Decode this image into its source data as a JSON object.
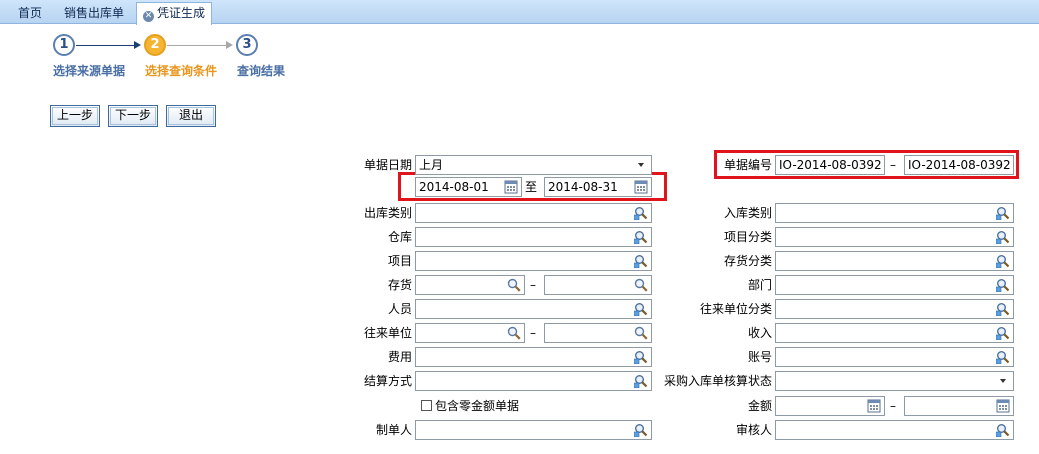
{
  "tabs": [
    {
      "label": "首页",
      "active": false
    },
    {
      "label": "销售出库单",
      "active": false
    },
    {
      "label": "凭证生成",
      "active": true
    }
  ],
  "wizard": {
    "steps": [
      {
        "number": "1",
        "label": "选择来源单据",
        "state": "done"
      },
      {
        "number": "2",
        "label": "选择查询条件",
        "state": "current"
      },
      {
        "number": "3",
        "label": "查询结果",
        "state": "pending"
      }
    ]
  },
  "buttons": {
    "prev": "上一步",
    "next": "下一步",
    "exit": "退出"
  },
  "form": {
    "doc_date": {
      "label": "单据日期",
      "value": "上月",
      "from": "2014-08-01",
      "to_sep": "至",
      "to": "2014-08-31"
    },
    "doc_number": {
      "label": "单据编号",
      "from": "IO-2014-08-0392",
      "sep": "–",
      "to": "IO-2014-08-0392"
    },
    "out_type": {
      "label": "出库类别",
      "value": ""
    },
    "in_type": {
      "label": "入库类别",
      "value": ""
    },
    "warehouse": {
      "label": "仓库",
      "value": ""
    },
    "project_class": {
      "label": "项目分类",
      "value": ""
    },
    "project": {
      "label": "项目",
      "value": ""
    },
    "stock_class": {
      "label": "存货分类",
      "value": ""
    },
    "stock": {
      "label": "存货",
      "from": "",
      "sep": "–",
      "to": ""
    },
    "department": {
      "label": "部门",
      "value": ""
    },
    "staff": {
      "label": "人员",
      "value": ""
    },
    "partner_class": {
      "label": "往来单位分类",
      "value": ""
    },
    "partner": {
      "label": "往来单位",
      "from": "",
      "sep": "–",
      "to": ""
    },
    "income": {
      "label": "收入",
      "value": ""
    },
    "expense": {
      "label": "费用",
      "value": ""
    },
    "account": {
      "label": "账号",
      "value": ""
    },
    "settle_method": {
      "label": "结算方式",
      "value": ""
    },
    "purchase_status": {
      "label": "采购入库单核算状态",
      "value": ""
    },
    "include_zero": {
      "label": "包含零金额单据",
      "checked": false
    },
    "amount": {
      "label": "金额",
      "from": "",
      "sep": "–",
      "to": ""
    },
    "creator": {
      "label": "制单人",
      "value": ""
    },
    "reviewer": {
      "label": "审核人",
      "value": ""
    }
  },
  "colors": {
    "highlight": "#e0141c",
    "step_current": "#f5b531",
    "step_label": "#4a6fa5",
    "step_label_current": "#e8961e"
  }
}
